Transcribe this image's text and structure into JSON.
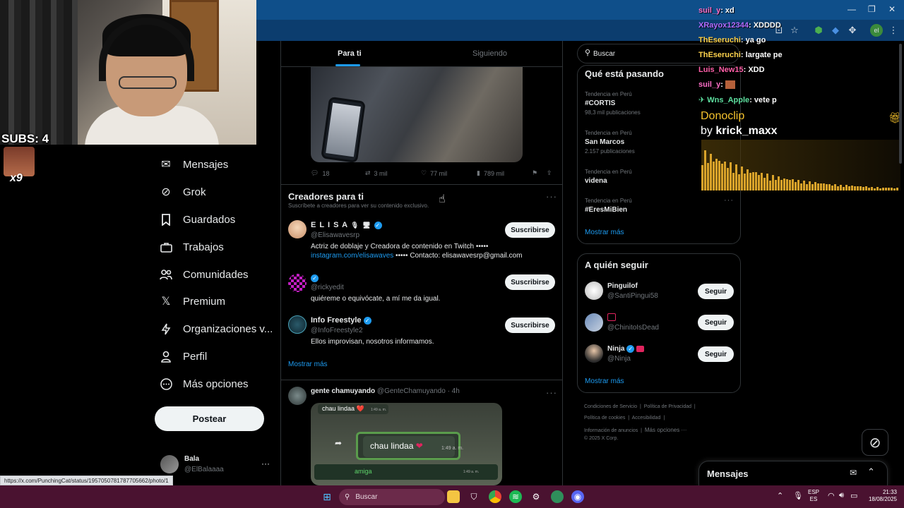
{
  "stream": {
    "subs_label": "SUBS: 4",
    "emote_count": "x9",
    "donoclip_title": "Donoclip",
    "donoclip_by_prefix": "by",
    "donoclip_by_user": "krick_maxx",
    "chat": [
      {
        "user": "suil_y",
        "text": "xd",
        "color": "#ff6ec7"
      },
      {
        "user": "XRayox12344",
        "text": "XDDDD",
        "color": "#b36bff"
      },
      {
        "user": "ThEseruchi",
        "text": "ya go",
        "color": "#ffd34d"
      },
      {
        "user": "ThEseruchi",
        "text": "largate pe",
        "color": "#ffd34d"
      },
      {
        "user": "Luis_New15",
        "text": "XDD",
        "color": "#ff5fa8"
      },
      {
        "user": "suil_y",
        "text": "",
        "color": "#ff6ec7"
      },
      {
        "user": "Wns_Apple",
        "text": "vete p",
        "color": "#5ee0a0"
      }
    ]
  },
  "nav": {
    "items": [
      {
        "label": "Mensajes",
        "icon": "mail-icon"
      },
      {
        "label": "Grok",
        "icon": "grok-icon"
      },
      {
        "label": "Guardados",
        "icon": "bookmark-icon"
      },
      {
        "label": "Trabajos",
        "icon": "briefcase-icon"
      },
      {
        "label": "Comunidades",
        "icon": "people-icon"
      },
      {
        "label": "Premium",
        "icon": "x-logo-icon"
      },
      {
        "label": "Organizaciones v...",
        "icon": "lightning-icon"
      },
      {
        "label": "Perfil",
        "icon": "person-icon"
      },
      {
        "label": "Más opciones",
        "icon": "more-circle-icon"
      }
    ],
    "post_label": "Postear",
    "account": {
      "name": "Bala",
      "handle": "@ElBalaaaa"
    }
  },
  "timeline": {
    "tabs": [
      "Para ti",
      "Siguiendo"
    ],
    "actions": [
      {
        "icon": "reply-icon",
        "count": "18"
      },
      {
        "icon": "repost-icon",
        "count": "3 mil"
      },
      {
        "icon": "like-icon",
        "count": "77 mil"
      },
      {
        "icon": "views-icon",
        "count": "789 mil"
      }
    ],
    "creators": {
      "title": "Creadores para ti",
      "subtitle": "Suscríbete a creadores para ver su contenido exclusivo.",
      "button_label": "Suscribirse",
      "show_more": "Mostrar más",
      "items": [
        {
          "name": "E L I S A",
          "handle": "@Elisawavesrp",
          "bio": "Actriz de doblaje y Creadora de contenido en Twitch •••••",
          "link": "instagram.com/elisawaves",
          "bio2": "••••• Contacto: elisawavesrp@gmail.com"
        },
        {
          "name": "",
          "handle": "@rickyedit",
          "bio": "quiéreme o equivócate, a mí me da igual."
        },
        {
          "name": "Info Freestyle",
          "handle": "@InfoFreestyle2",
          "bio": "Ellos improvisan, nosotros informamos."
        }
      ]
    },
    "post": {
      "name": "gente chamuyando",
      "handle": "@GenteChamuyando",
      "time": "· 4h",
      "chat_top": "chau lindaa ❤️",
      "chat_time_small": "1:49 a. m.",
      "chat_main": "chau lindaa",
      "chat_main_time": "1:49 a. m.",
      "chat_sender": "amiga",
      "chat_small_time2": "1:49 a. m."
    }
  },
  "sidebar": {
    "search_placeholder": "Buscar",
    "trends_title": "Qué está pasando",
    "trends": [
      {
        "context": "Tendencia en Perú",
        "name": "#CORTIS",
        "count": "98,3 mil publicaciones"
      },
      {
        "context": "Tendencia en Perú",
        "name": "San Marcos",
        "count": "2.157 publicaciones"
      },
      {
        "context": "Tendencia en Perú",
        "name": "videna",
        "count": ""
      },
      {
        "context": "Tendencia en Perú",
        "name": "#EresMiBien",
        "count": ""
      }
    ],
    "trends_more": "Mostrar más",
    "follow_title": "A quién seguir",
    "follow_label": "Seguir",
    "follow_more": "Mostrar más",
    "follow": [
      {
        "name": "Pinguilof",
        "handle": "@SantiPingui58"
      },
      {
        "name": "",
        "handle": "@ChinitoIsDead"
      },
      {
        "name": "Ninja",
        "handle": "@Ninja"
      }
    ],
    "footer": [
      "Condiciones de Servicio",
      "Política de Privacidad",
      "Política de cookies",
      "Accesibilidad",
      "Información de anuncios",
      "Más opciones ···",
      "© 2025 X Corp."
    ],
    "messages_label": "Mensajes"
  },
  "browser": {
    "status_url": "https://x.com/PunchingCat/status/1957050781787705662/photo/1"
  },
  "taskbar": {
    "search_label": "Buscar",
    "lang_top": "ESP",
    "lang_bottom": "ES",
    "time": "21:33",
    "date": "18/08/2025"
  }
}
